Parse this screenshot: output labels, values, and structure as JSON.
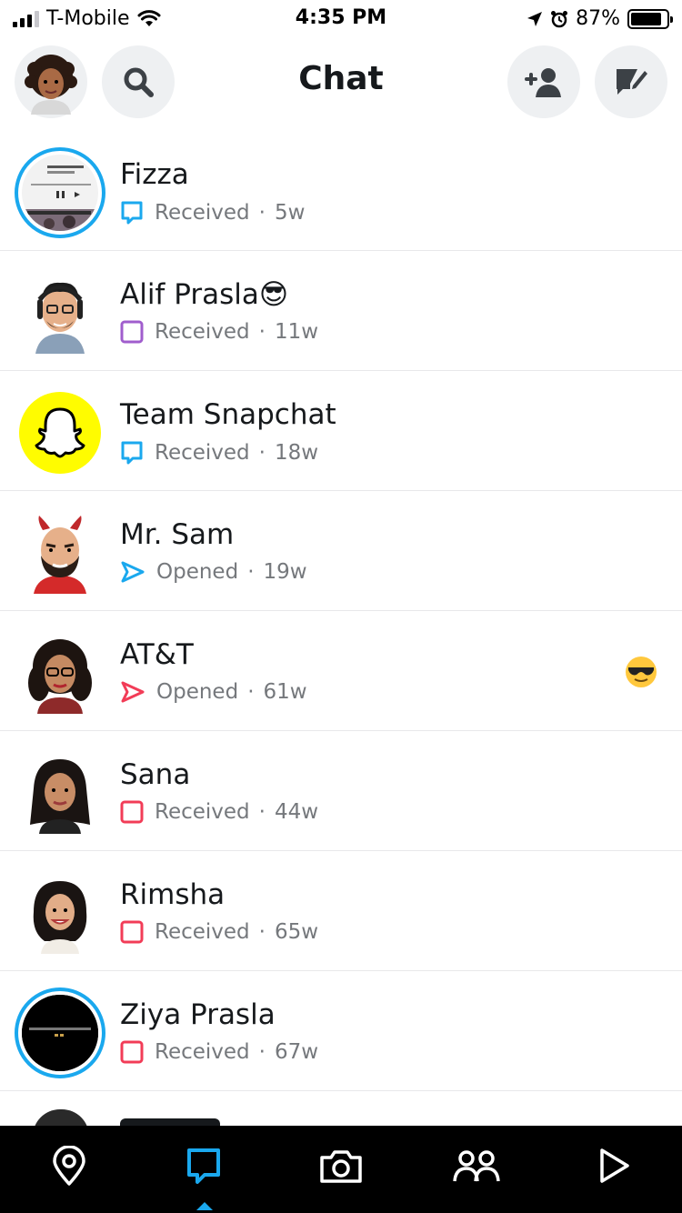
{
  "status_bar": {
    "carrier": "T-Mobile",
    "time": "4:35 PM",
    "battery_percent": "87%",
    "battery_level": 0.87
  },
  "header": {
    "title": "Chat",
    "icons": [
      "bitmoji-avatar",
      "search-icon",
      "add-friend-icon",
      "new-chat-icon"
    ]
  },
  "chats": [
    {
      "name": "Fizza",
      "status": "Received",
      "time": "5w",
      "icon": "chat-bubble-icon",
      "icon_color": "#1aa8ee",
      "has_story": true
    },
    {
      "name": "Alif Prasla",
      "status": "Received",
      "time": "11w",
      "icon": "chat-bubble-icon",
      "icon_color": "#a05dcd",
      "name_emoji": "😎"
    },
    {
      "name": "Team Snapchat",
      "status": "Received",
      "time": "18w",
      "icon": "chat-bubble-icon",
      "icon_color": "#1aa8ee"
    },
    {
      "name": "Mr. Sam",
      "status": "Opened",
      "time": "19w",
      "icon": "opened-arrow-icon",
      "icon_color": "#1aa8ee"
    },
    {
      "name": "AT&T",
      "status": "Opened",
      "time": "61w",
      "icon": "opened-arrow-icon",
      "icon_color": "#f23c57",
      "friend_emoji": "😎"
    },
    {
      "name": "Sana",
      "status": "Received",
      "time": "44w",
      "icon": "snap-square-icon",
      "icon_color": "#f23c57"
    },
    {
      "name": "Rimsha",
      "status": "Received",
      "time": "65w",
      "icon": "snap-square-icon",
      "icon_color": "#f23c57"
    },
    {
      "name": "Ziya Prasla",
      "status": "Received",
      "time": "67w",
      "icon": "snap-square-icon",
      "icon_color": "#f23c57",
      "has_story": true
    }
  ],
  "separator": "·",
  "nav": {
    "items": [
      "map-icon",
      "chat-icon",
      "camera-icon",
      "friends-icon",
      "discover-icon"
    ],
    "active": "chat-icon",
    "active_color": "#1aa8ee"
  }
}
